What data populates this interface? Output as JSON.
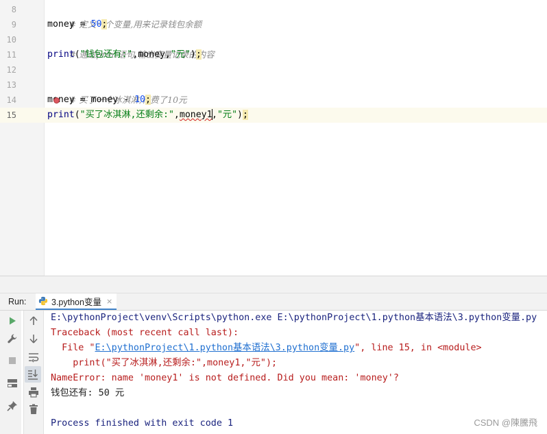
{
  "editor": {
    "line_numbers": [
      "8",
      "9",
      "10",
      "11",
      "12",
      "13",
      "14",
      "15"
    ],
    "line8": {
      "comment": "# 定义一个变量,用来记录钱包余额"
    },
    "line9": {
      "var": "money",
      "op": " = ",
      "num": "50",
      "semi": ";"
    },
    "line10": {
      "comment": "# 通过print语句,输出变量记录的内容"
    },
    "line11": {
      "fn": "print",
      "open": "(",
      "str1": "\"钱包还有:\"",
      "sep1": ",",
      "arg": "money",
      "sep2": ",",
      "str2": "\"元\"",
      "close": ")",
      "semi": ";"
    },
    "line13": {
      "comment": "# 买了一个冰淇淋,花费了10元"
    },
    "line14": {
      "var_a": "mo",
      "var_b": "ney",
      "op": " = money - ",
      "num": "10",
      "semi": ";"
    },
    "line15": {
      "fn": "print",
      "open": "(",
      "str1": "\"买了冰淇淋,还剩余:\"",
      "sep1": ",",
      "arg": "money1",
      "sep2": ",",
      "str2": "\"元\"",
      "close": ")",
      "semi": ";"
    }
  },
  "run": {
    "label": "Run:",
    "tab_label": "3.python变量",
    "tab_close": "×",
    "icons": [
      "run-icon",
      "up-arrow-icon",
      "wrench-icon",
      "down-arrow-icon",
      "stop-icon",
      "soft-wrap-icon",
      "layout-icon",
      "scroll-to-end-icon",
      "pin-icon",
      "print-icon",
      "trash-icon"
    ]
  },
  "console": {
    "line1": "E:\\pythonProject\\venv\\Scripts\\python.exe E:\\pythonProject\\1.python基本语法\\3.python变量.py",
    "line2": "Traceback (most recent call last):",
    "line3_prefix": "  File \"",
    "line3_link": "E:\\pythonProject\\1.python基本语法\\3.python变量.py",
    "line3_suffix": "\", line 15, in <module>",
    "line4": "    print(\"买了冰淇淋,还剩余:\",money1,\"元\");",
    "line5": "NameError: name 'money1' is not defined. Did you mean: 'money'?",
    "line6": "钱包还有: 50 元",
    "line8": "Process finished with exit code 1"
  },
  "watermark": "CSDN @陳騰飛",
  "colors": {
    "comment": "#8c8c8c",
    "number": "#1750eb",
    "string": "#067d17",
    "builtin": "#000080",
    "console_blue": "#1a237e",
    "console_red": "#b71c1c",
    "link": "#1f6fd0"
  }
}
